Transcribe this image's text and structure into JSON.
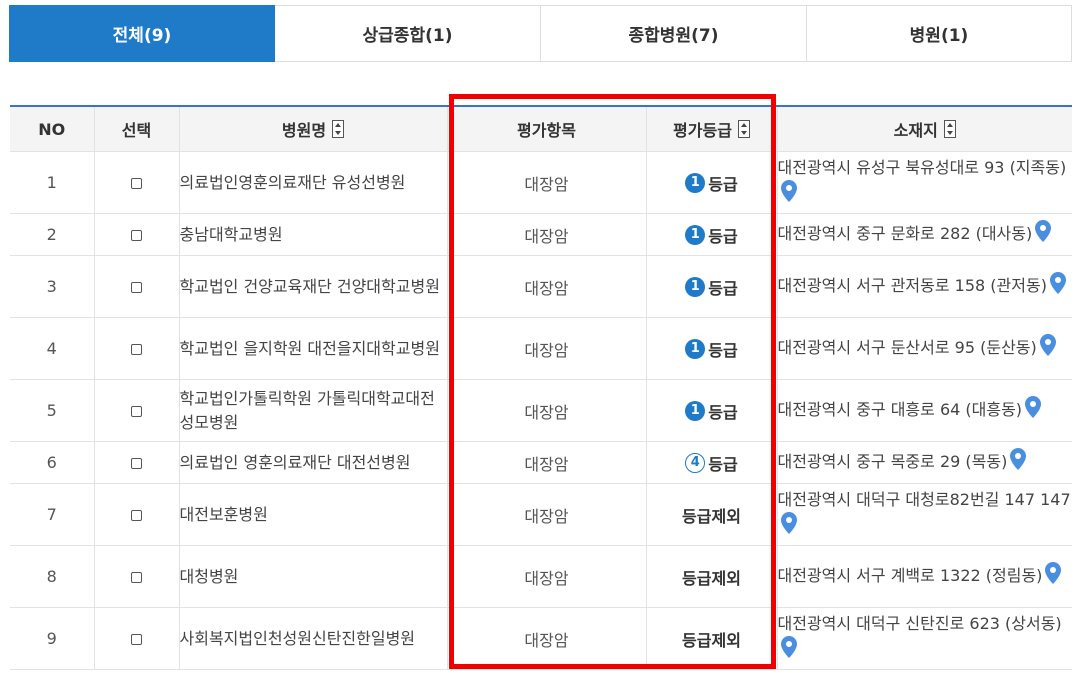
{
  "tabs": [
    {
      "label": "전체(9)",
      "active": true
    },
    {
      "label": "상급종합(1)",
      "active": false
    },
    {
      "label": "종합병원(7)",
      "active": false
    },
    {
      "label": "병원(1)",
      "active": false
    }
  ],
  "table": {
    "headers": {
      "no": "NO",
      "select": "선택",
      "name": "병원명",
      "item": "평가항목",
      "grade": "평가등급",
      "address": "소재지"
    },
    "rows": [
      {
        "no": "1",
        "name": "의료법인영훈의료재단 유성선병원",
        "item": "대장암",
        "grade_num": "1",
        "grade_text": "등급",
        "address": "대전광역시 유성구 북유성대로 93 (지족동)"
      },
      {
        "no": "2",
        "name": "충남대학교병원",
        "item": "대장암",
        "grade_num": "1",
        "grade_text": "등급",
        "address": "대전광역시 중구 문화로 282 (대사동)"
      },
      {
        "no": "3",
        "name": "학교법인 건양교육재단 건양대학교병원",
        "item": "대장암",
        "grade_num": "1",
        "grade_text": "등급",
        "address": "대전광역시 서구 관저동로 158 (관저동)"
      },
      {
        "no": "4",
        "name": "학교법인 을지학원 대전을지대학교병원",
        "item": "대장암",
        "grade_num": "1",
        "grade_text": "등급",
        "address": "대전광역시 서구 둔산서로 95 (둔산동)"
      },
      {
        "no": "5",
        "name": "학교법인가톨릭학원 가톨릭대학교대전성모병원",
        "item": "대장암",
        "grade_num": "1",
        "grade_text": "등급",
        "address": "대전광역시 중구 대흥로 64 (대흥동)"
      },
      {
        "no": "6",
        "name": "의료법인 영훈의료재단 대전선병원",
        "item": "대장암",
        "grade_num": "4",
        "grade_text": "등급",
        "address": "대전광역시 중구 목중로 29 (목동)"
      },
      {
        "no": "7",
        "name": "대전보훈병원",
        "item": "대장암",
        "grade_num": "",
        "grade_text": "등급제외",
        "address": "대전광역시 대덕구 대청로82번길 147 147"
      },
      {
        "no": "8",
        "name": "대청병원",
        "item": "대장암",
        "grade_num": "",
        "grade_text": "등급제외",
        "address": "대전광역시 서구 계백로 1322 (정림동)"
      },
      {
        "no": "9",
        "name": "사회복지법인천성원신탄진한일병원",
        "item": "대장암",
        "grade_num": "",
        "grade_text": "등급제외",
        "address": "대전광역시 대덕구 신탄진로 623 (상서동)"
      }
    ]
  },
  "colors": {
    "accent": "#1f7bc8",
    "highlight": "#f20000",
    "pin": "#4a8ee0"
  },
  "icons": {
    "sort": "sort-icon",
    "map": "map-pin-icon",
    "checkbox": "checkbox"
  }
}
